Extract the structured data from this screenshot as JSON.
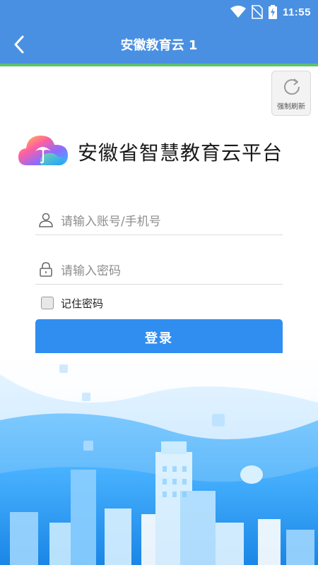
{
  "status_bar": {
    "time": "11:55",
    "icons": [
      "wifi-icon",
      "no-sim-icon",
      "battery-charging-icon"
    ]
  },
  "app_bar": {
    "back_icon": "chevron-left-icon",
    "title": "安徽教育云 1"
  },
  "refresh": {
    "icon": "refresh-icon",
    "label": "强制刷新"
  },
  "brand": {
    "logo_icon": "cloud-logo-icon",
    "title": "安徽省智慧教育云平台"
  },
  "form": {
    "account": {
      "icon": "user-icon",
      "placeholder": "请输入账号/手机号"
    },
    "password": {
      "icon": "lock-icon",
      "placeholder": "请输入密码"
    },
    "remember_label": "记住密码",
    "remember_checked": false,
    "login_label": "登录"
  },
  "colors": {
    "header": "#4a90e2",
    "progress": "#5cc36a",
    "button": "#2f8ef0"
  }
}
